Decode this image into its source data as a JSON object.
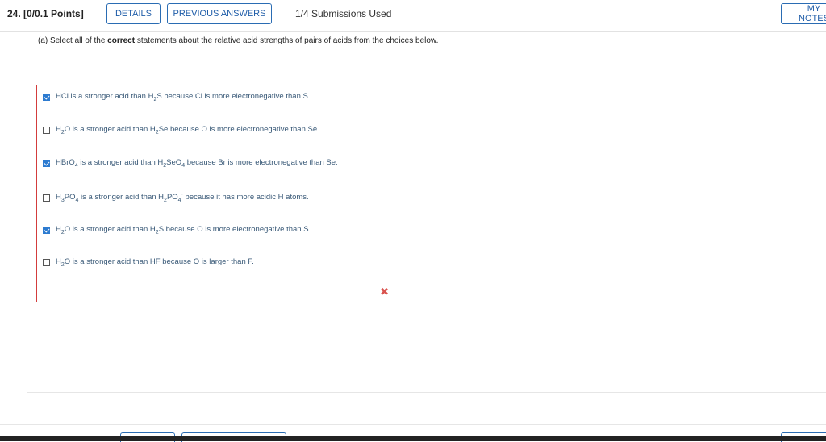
{
  "header": {
    "question_number": "24.",
    "points": "[0/0.1 Points]",
    "details_label": "DETAILS",
    "previous_answers_label": "PREVIOUS ANSWERS",
    "submissions": "1/4 Submissions Used",
    "my_notes_label": "MY NOTES"
  },
  "question": {
    "prompt_prefix": "(a) Select all of the ",
    "prompt_emphasis": "correct",
    "prompt_suffix": " statements about the relative acid strengths of pairs of acids from the choices below.",
    "choices": [
      {
        "checked": true,
        "text_parts": [
          "HCl is a stronger acid than H",
          "2",
          "S because Cl is more electronegative than S."
        ]
      },
      {
        "checked": false,
        "text_parts": [
          "H",
          "2",
          "O is a stronger acid than H",
          "2",
          "Se because O is more electronegative than Se."
        ]
      },
      {
        "checked": true,
        "text_parts": [
          "HBrO",
          "4",
          " is a stronger acid than H",
          "2",
          "SeO",
          "4",
          " because Br is more electronegative than Se."
        ]
      },
      {
        "checked": false,
        "text_parts": [
          "H",
          "3",
          "PO",
          "4",
          " is a stronger acid than H",
          "2",
          "PO",
          "4",
          "-",
          " because it has more acidic H atoms."
        ]
      },
      {
        "checked": true,
        "text_parts": [
          "H",
          "2",
          "O is a stronger acid than H",
          "2",
          "S because O is more electronegative than S."
        ]
      },
      {
        "checked": false,
        "text_parts": [
          "H",
          "2",
          "O is a stronger acid than HF because O is larger than F."
        ]
      }
    ],
    "result_icon": "incorrect-x-icon",
    "result_symbol": "✖"
  },
  "colors": {
    "accent": "#2a6cb3",
    "error": "#d33c3c",
    "checkbox_checked": "#2d7bd0"
  }
}
